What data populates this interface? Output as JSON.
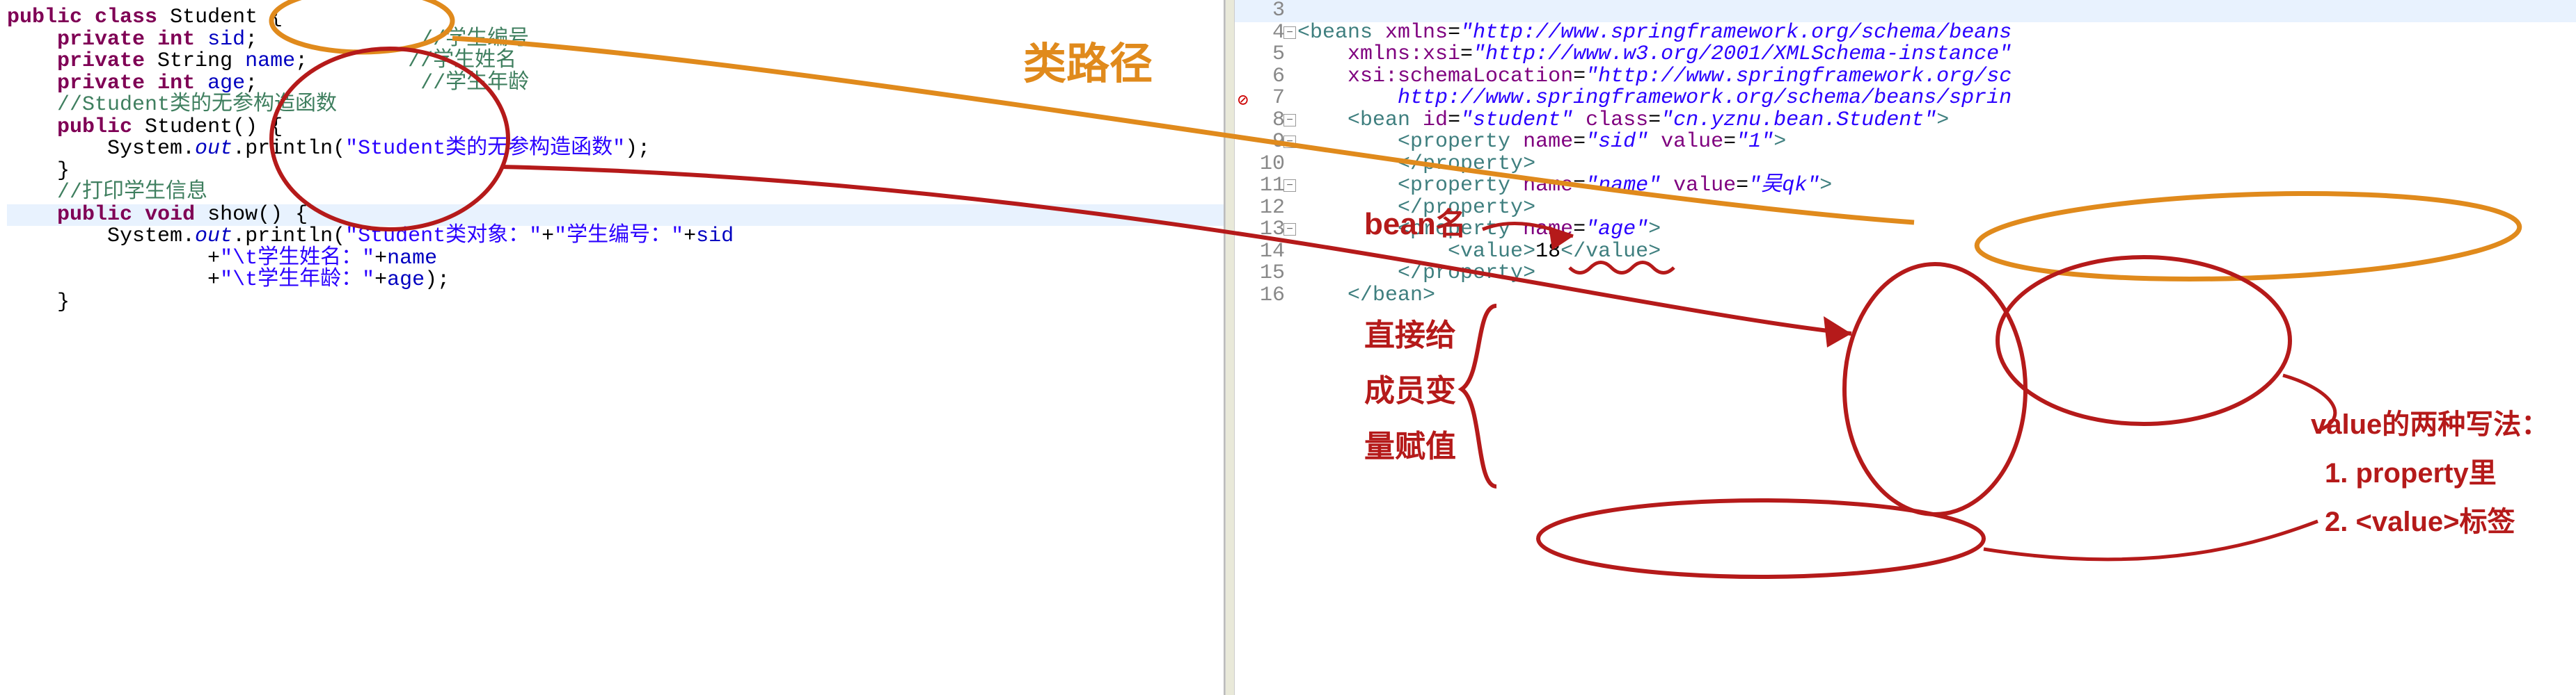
{
  "left": {
    "lines": {
      "l1a": "public",
      "l1b": " class ",
      "l1c": "Student",
      "l1d": " {",
      "l2a": "    ",
      "l2b": "private",
      "l2c": " ",
      "l2d": "int",
      "l2e": " ",
      "l2f": "sid",
      "l2g": ";",
      "l2h": "             ",
      "l2i": "//学生编号",
      "l3a": "    ",
      "l3b": "private",
      "l3c": " String ",
      "l3d": "name",
      "l3e": ";",
      "l3f": "        ",
      "l3g": "//学生姓名",
      "l4a": "    ",
      "l4b": "private",
      "l4c": " ",
      "l4d": "int",
      "l4e": " ",
      "l4f": "age",
      "l4g": ";",
      "l4h": "             ",
      "l4i": "//学生年龄",
      "l5": "    //Student类的无参构造函数",
      "l6a": "    ",
      "l6b": "public",
      "l6c": " Student() {",
      "l7a": "        System.",
      "l7b": "out",
      "l7c": ".println(",
      "l7d": "\"Student类的无参构造函数\"",
      "l7e": ");",
      "l8": "    }",
      "l9": "    //打印学生信息",
      "l10a": "    ",
      "l10b": "public",
      "l10c": " ",
      "l10d": "void",
      "l10e": " show() {",
      "l11a": "        System.",
      "l11b": "out",
      "l11c": ".println(",
      "l11d": "\"Student类对象：\"",
      "l11e": "+",
      "l11f": "\"学生编号：\"",
      "l11g": "+",
      "l11h": "sid",
      "l12a": "                +",
      "l12b": "\"\\t学生姓名：\"",
      "l12c": "+",
      "l12d": "name",
      "l13a": "                +",
      "l13b": "\"\\t学生年龄：\"",
      "l13c": "+",
      "l13d": "age",
      "l13e": ");",
      "l14": "    }"
    }
  },
  "right": {
    "nums": {
      "n3": "3",
      "n4": "4",
      "n5": "5",
      "n6": "6",
      "n7": "7",
      "n8": "8",
      "n9": "9",
      "n10": "10",
      "n11": "11",
      "n12": "12",
      "n13": "13",
      "n14": "14",
      "n15": "15",
      "n16": "16"
    },
    "lines": {
      "r3": " ",
      "r4a": "<",
      "r4b": "beans",
      "r4c": " ",
      "r4d": "xmlns",
      "r4e": "=",
      "r4f": "\"http://www.springframework.org/schema/beans",
      "r5a": "    ",
      "r5b": "xmlns:xsi",
      "r5c": "=",
      "r5d": "\"http://www.w3.org/2001/XMLSchema-instance\"",
      "r6a": "    ",
      "r6b": "xsi:schemaLocation",
      "r6c": "=",
      "r6d": "\"http://www.springframework.org/sc",
      "r7": "        http://www.springframework.org/schema/beans/sprin",
      "r8a": "    <",
      "r8b": "bean",
      "r8c": " ",
      "r8d": "id",
      "r8e": "=",
      "r8f": "\"student\"",
      "r8g": " ",
      "r8h": "class",
      "r8i": "=",
      "r8j": "\"cn.yznu.bean.Student\"",
      "r8k": ">",
      "r9a": "        <",
      "r9b": "property",
      "r9c": " ",
      "r9d": "name",
      "r9e": "=",
      "r9f": "\"sid\"",
      "r9g": " ",
      "r9h": "value",
      "r9i": "=",
      "r9j": "\"1\"",
      "r9k": ">",
      "r10a": "        </",
      "r10b": "property",
      "r10c": ">",
      "r11a": "        <",
      "r11b": "property",
      "r11c": " ",
      "r11d": "name",
      "r11e": "=",
      "r11f": "\"name\"",
      "r11g": " ",
      "r11h": "value",
      "r11i": "=",
      "r11j": "\"吴qk\"",
      "r11k": ">",
      "r12a": "        </",
      "r12b": "property",
      "r12c": ">",
      "r13a": "        <",
      "r13b": "property",
      "r13c": " ",
      "r13d": "name",
      "r13e": "=",
      "r13f": "\"age\"",
      "r13g": ">",
      "r14a": "            <",
      "r14b": "value",
      "r14c": ">",
      "r14d": "18",
      "r14e": "</",
      "r14f": "value",
      "r14g": ">",
      "r15a": "        </",
      "r15b": "property",
      "r15c": ">",
      "r16a": "    </",
      "r16b": "bean",
      "r16c": ">"
    }
  },
  "annotations": {
    "classpath": "类路径",
    "beanname": "bean名",
    "direct1": "直接给",
    "direct2": "成员变",
    "direct3": "量赋值",
    "valuetitle": "value的两种写法：",
    "value1": "1. property里",
    "value2": "2. <value>标签"
  }
}
